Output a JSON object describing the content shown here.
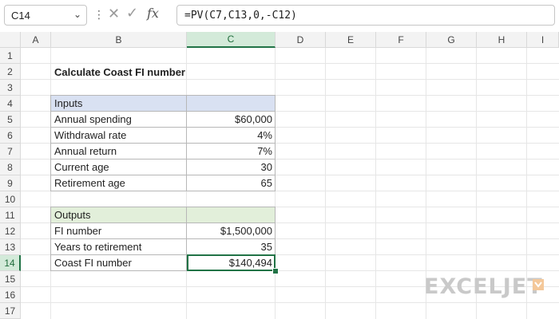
{
  "formula_bar": {
    "name_box": "C14",
    "dropdown_glyph": "⌄",
    "separator": "⋮",
    "cancel_glyph": "✕",
    "enter_glyph": "✓",
    "fx_label": "fx",
    "formula": "=PV(C7,C13,0,-C12)"
  },
  "columns": [
    "A",
    "B",
    "C",
    "D",
    "E",
    "F",
    "G",
    "H",
    "I"
  ],
  "active_column": "C",
  "rows": [
    "1",
    "2",
    "3",
    "4",
    "5",
    "6",
    "7",
    "8",
    "9",
    "10",
    "11",
    "12",
    "13",
    "14",
    "15",
    "16",
    "17"
  ],
  "active_row": "14",
  "sheet": {
    "title": "Calculate Coast FI number",
    "inputs": {
      "header": "Inputs",
      "items": [
        {
          "label": "Annual spending",
          "value": "$60,000"
        },
        {
          "label": "Withdrawal rate",
          "value": "4%"
        },
        {
          "label": "Annual return",
          "value": "7%"
        },
        {
          "label": "Current age",
          "value": "30"
        },
        {
          "label": "Retirement age",
          "value": "65"
        }
      ]
    },
    "outputs": {
      "header": "Outputs",
      "items": [
        {
          "label": "FI number",
          "value": "$1,500,000"
        },
        {
          "label": "Years to retirement",
          "value": "35"
        },
        {
          "label": "Coast FI number",
          "value": "$140,494"
        }
      ]
    }
  },
  "brand": {
    "logo_text": "EXCELJET",
    "accent": "#217346",
    "inputs_fill": "#d9e1f2",
    "outputs_fill": "#e2efda"
  }
}
